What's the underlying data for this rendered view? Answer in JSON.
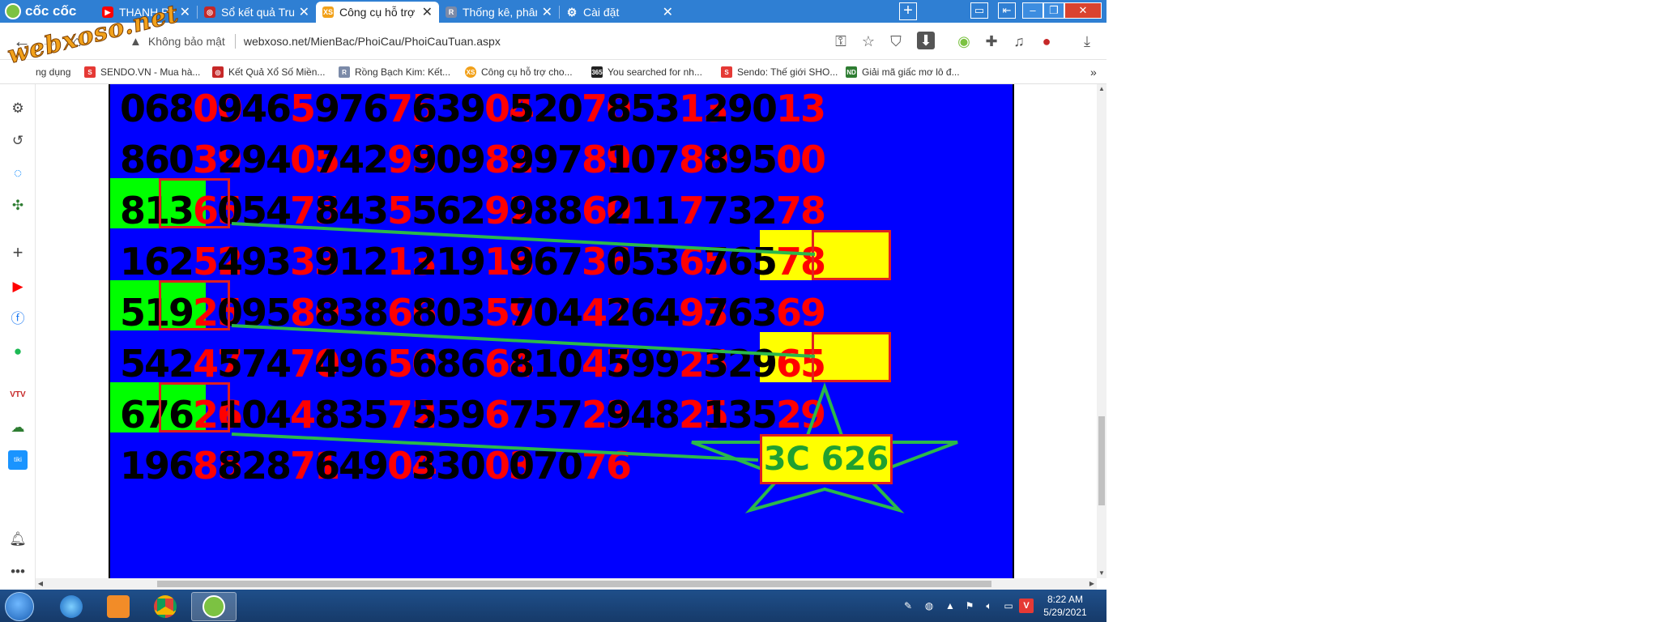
{
  "browser": {
    "brand": "cốc cốc",
    "tabs": [
      {
        "label": "THANH PHONG SOI C",
        "favicon": "youtube-icon",
        "fav_color": "#ff0000",
        "active": false
      },
      {
        "label": "Sổ kết quả Truyền Thố",
        "favicon": "lottery-icon",
        "fav_color": "#c62828",
        "active": false
      },
      {
        "label": "Công cụ hỗ trợ cho ng",
        "favicon": "xs-icon",
        "fav_color": "#f2a11a",
        "active": true
      },
      {
        "label": "Thống kê, phân tích k",
        "favicon": "rbk-icon",
        "fav_color": "#7b8aa8",
        "active": false
      },
      {
        "label": "Cài đặt",
        "favicon": "gear-icon",
        "fav_color": "#5f6368",
        "active": false
      }
    ],
    "security_label": "Không bảo mật",
    "url": "webxoso.net/MienBac/PhoiCau/PhoiCauTuan.aspx"
  },
  "bookmarks": [
    {
      "label": "ng dụng",
      "fav_color": "#5f6368"
    },
    {
      "label": "SENDO.VN - Mua hà...",
      "fav_color": "#e53935"
    },
    {
      "label": "Kết Quả Xổ Số Miền...",
      "fav_color": "#c62828"
    },
    {
      "label": "Rồng Bạch Kim: Kết...",
      "fav_color": "#7b8aa8"
    },
    {
      "label": "Công cụ hỗ trợ cho...",
      "fav_color": "#f2a11a"
    },
    {
      "label": "You searched for nh...",
      "fav_color": "#222222",
      "badge": "365"
    },
    {
      "label": "Sendo: Thế giới SHO...",
      "fav_color": "#e53935"
    },
    {
      "label": "Giải mã giấc mơ lô đ...",
      "fav_color": "#2e7d32",
      "badge": "ND"
    }
  ],
  "watermark": "webxoso.net",
  "board": {
    "background": "#0000ff",
    "rows": [
      [
        "06800",
        "94659",
        "97675",
        "63904",
        "52070",
        "85313",
        "29013"
      ],
      [
        "86039",
        "29405",
        "74295",
        "90982",
        "99789",
        "10780",
        "89500"
      ],
      [
        "81365",
        "05475",
        "84355",
        "56292",
        "98860",
        "21177",
        "73278"
      ],
      [
        "16252",
        "49333",
        "91213",
        "21916",
        "96736",
        "05365",
        "76578"
      ],
      [
        "51925",
        "09580",
        "83866",
        "80359",
        "70447",
        "26493",
        "76369"
      ],
      [
        "54247",
        "57470",
        "49650",
        "68664",
        "81047",
        "59925",
        "32965"
      ],
      [
        "67626",
        "10448",
        "83572",
        "55967",
        "75723",
        "94825",
        "13529"
      ],
      [
        "19685",
        "82871",
        "64904",
        "33003",
        "07076",
        "",
        ""
      ]
    ],
    "result": "3C 626"
  },
  "sidebar_icons": [
    "gear-icon",
    "history-icon",
    "messenger-icon",
    "game-icon",
    "plus-icon",
    "youtube-icon",
    "facebook-icon",
    "spotify-icon",
    "vtv-icon",
    "cloud-icon",
    "tiki-icon",
    "bell-icon",
    "more-icon"
  ],
  "taskbar": {
    "time": "8:22 AM",
    "date": "5/29/2021"
  }
}
